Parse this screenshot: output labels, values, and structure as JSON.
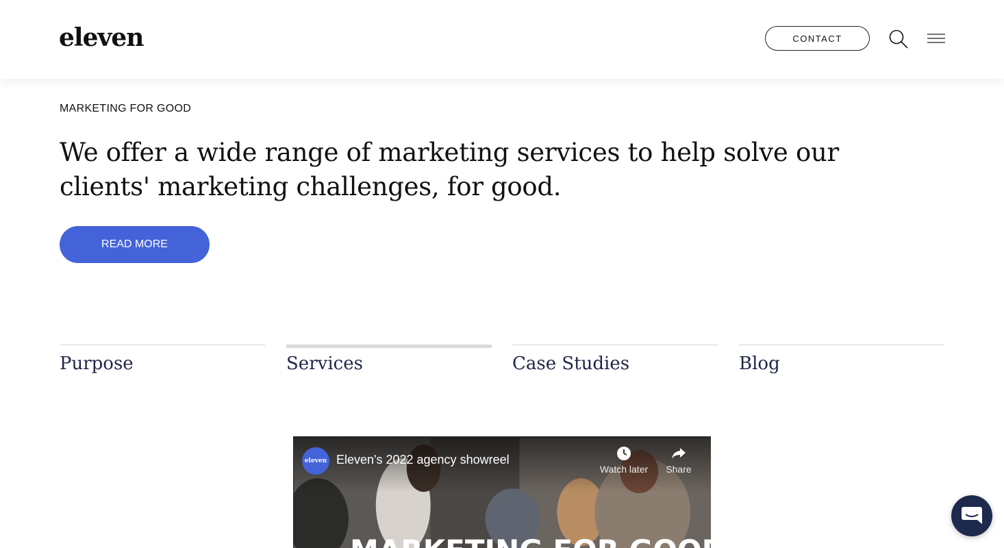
{
  "header": {
    "logo": "eleven",
    "contact_label": "CONTACT"
  },
  "hero": {
    "eyebrow": "MARKETING FOR GOOD",
    "headline": "We offer a wide range of marketing services to help solve our clients' marketing challenges, for good.",
    "cta_label": "READ MORE"
  },
  "tabs": [
    {
      "label": "Purpose",
      "active": false
    },
    {
      "label": "Services",
      "active": true
    },
    {
      "label": "Case Studies",
      "active": false
    },
    {
      "label": "Blog",
      "active": false
    }
  ],
  "video": {
    "channel_avatar_text": "eleven",
    "title": "Eleven's 2022 agency showreel",
    "watch_later_label": "Watch later",
    "share_label": "Share",
    "overlay_text": "MARKETING FOR GOOD"
  },
  "colors": {
    "accent": "#4463d8",
    "tab_text": "#1d2649",
    "chat": "#1d2a4d"
  }
}
